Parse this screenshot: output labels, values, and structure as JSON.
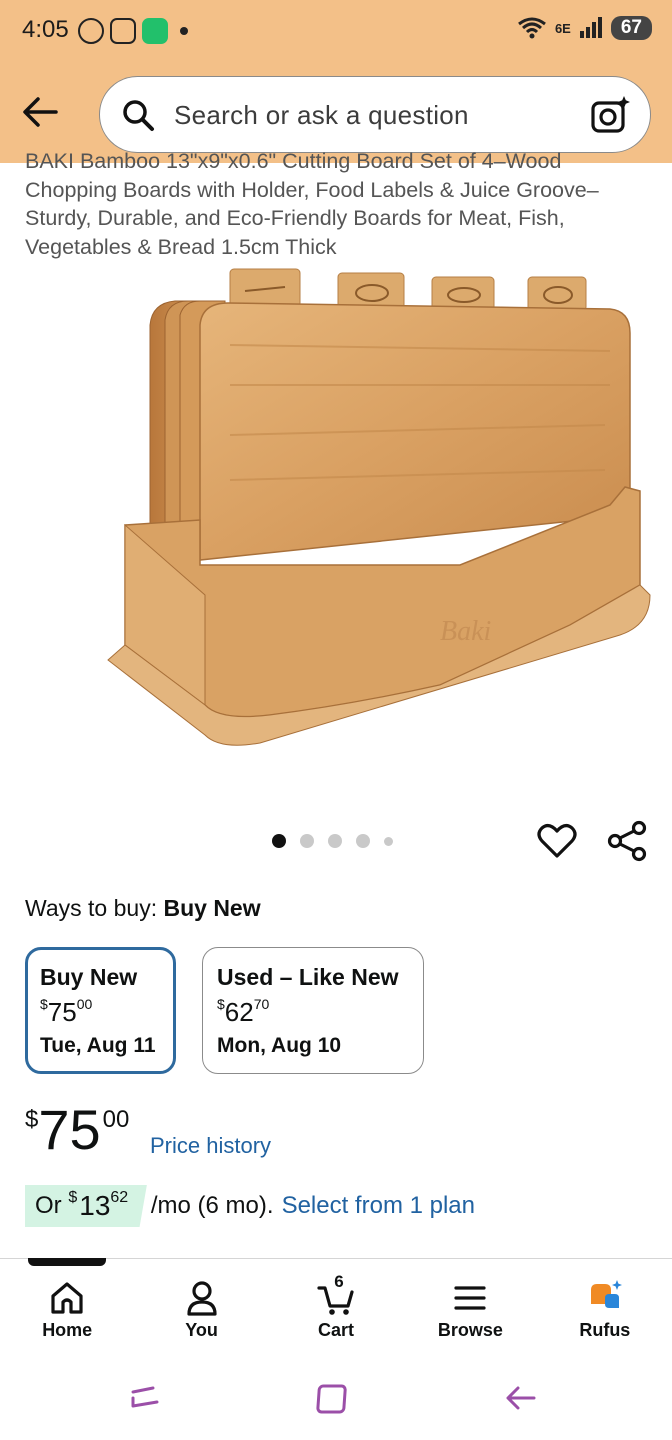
{
  "status_bar": {
    "time": "4:05",
    "network": "6E",
    "battery": "67",
    "icons": [
      "data-saver-icon",
      "screenshot-icon",
      "app-notification-icon",
      "dot-icon",
      "wifi-icon",
      "signal-icon",
      "battery-icon"
    ]
  },
  "header": {
    "back_icon": "back-arrow-icon",
    "search_placeholder": "Search or ask a question",
    "camera_icon": "camera-sparkle-icon",
    "background_color": "#f3c088"
  },
  "product": {
    "title": "BAKI Bamboo 13\"x9\"x0.6\" Cutting Board Set of 4–Wood Chopping Boards with Holder, Food Labels & Juice Groove–Sturdy, Durable, and Eco-Friendly Boards for Meat, Fish, Vegetables & Bread 1.5cm Thick",
    "image_label": "Baki",
    "image_count": 5,
    "active_image_index": 0
  },
  "actions": {
    "wishlist_icon": "heart-icon",
    "share_icon": "share-icon"
  },
  "ways_to_buy": {
    "label": "Ways to buy:",
    "selected": "Buy New",
    "options": [
      {
        "title": "Buy New",
        "currency": "$",
        "price_whole": "75",
        "price_frac": "00",
        "date": "Tue, Aug 11",
        "selected": true
      },
      {
        "title": "Used – Like New",
        "currency": "$",
        "price_whole": "62",
        "price_frac": "70",
        "date": "Mon, Aug 10",
        "selected": false
      }
    ]
  },
  "price": {
    "currency": "$",
    "whole": "75",
    "fraction": "00",
    "history_link": "Price history"
  },
  "installment": {
    "prefix": "Or",
    "currency": "$",
    "amount_whole": "13",
    "amount_frac": "62",
    "term": "/mo (6 mo).",
    "link": "Select from 1 plan",
    "highlight_color": "#d4f3e3"
  },
  "bottom_nav": {
    "items": [
      {
        "label": "Home",
        "icon": "home-icon"
      },
      {
        "label": "You",
        "icon": "person-icon"
      },
      {
        "label": "Cart",
        "icon": "cart-icon",
        "count": "6"
      },
      {
        "label": "Browse",
        "icon": "menu-icon"
      },
      {
        "label": "Rufus",
        "icon": "rufus-icon"
      }
    ]
  },
  "system_nav": {
    "icons": [
      "recents-icon",
      "home-square-icon",
      "back-icon"
    ],
    "color": "#9b4fa8"
  },
  "colors": {
    "link": "#2162a1",
    "selected_border": "#2f6a9e"
  }
}
